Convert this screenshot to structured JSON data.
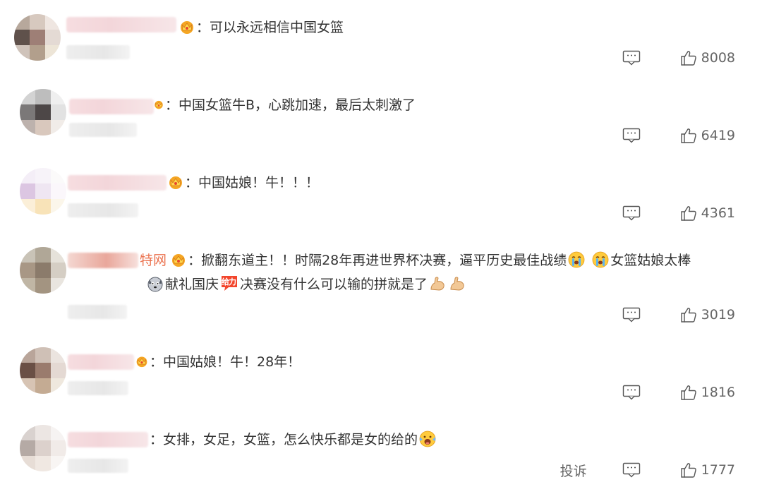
{
  "comments": [
    {
      "text": "：可以永远相信中国女篮",
      "likes": "8008"
    },
    {
      "text": "：中国女篮牛B，心跳加速，最后太刺激了",
      "likes": "6419"
    },
    {
      "text": "：中国姑娘！牛！！！",
      "likes": "4361"
    },
    {
      "source": "特网",
      "line1": "：掀翻东道主！！时隔28年再进世界杯决赛，逼平历史最佳战绩",
      "line1b": "女篮姑娘太棒",
      "line2a": "献礼国庆",
      "badge": "给力",
      "line2b": "决赛没有什么可以输的拼就是了",
      "likes": "3019"
    },
    {
      "text": "：中国姑娘！牛！28年！",
      "likes": "1816"
    },
    {
      "text": "：女排，女足，女篮，怎么快乐都是女的给的",
      "likes": "1777",
      "report": "投诉"
    }
  ],
  "icons": {
    "crown": "vip-crown-icon",
    "comment": "comment-icon",
    "like": "thumbs-up-icon",
    "cry": "crying-face-emoji",
    "muscle": "flexed-biceps-emoji",
    "husky": "dog-face-emoji",
    "scream": "screaming-face-emoji"
  },
  "colors": {
    "accent": "#eb7350",
    "text": "#333333",
    "muted": "#666666"
  }
}
